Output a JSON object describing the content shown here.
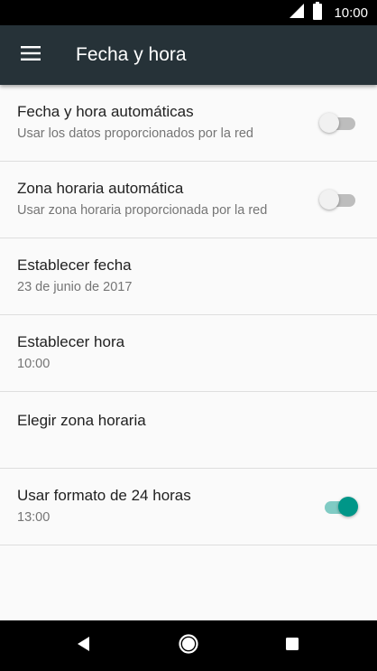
{
  "status_bar": {
    "time": "10:00",
    "icons": [
      "signal-icon",
      "battery-icon"
    ]
  },
  "app_bar": {
    "title": "Fecha y hora",
    "menu_icon": "menu-icon"
  },
  "settings": [
    {
      "title": "Fecha y hora automáticas",
      "subtitle": "Usar los datos proporcionados por la red",
      "switch": "off"
    },
    {
      "title": "Zona horaria automática",
      "subtitle": "Usar zona horaria proporcionada por la red",
      "switch": "off"
    },
    {
      "title": "Establecer fecha",
      "subtitle": "23 de junio de 2017"
    },
    {
      "title": "Establecer hora",
      "subtitle": "10:00"
    },
    {
      "title": "Elegir zona horaria"
    },
    {
      "title": "Usar formato de 24 horas",
      "subtitle": "13:00",
      "switch": "on"
    }
  ],
  "nav_bar": {
    "icons": [
      "back-icon",
      "home-icon",
      "recents-icon"
    ]
  },
  "colors": {
    "app_bar": "#263238",
    "accent": "#009688",
    "background": "#fafafa"
  }
}
